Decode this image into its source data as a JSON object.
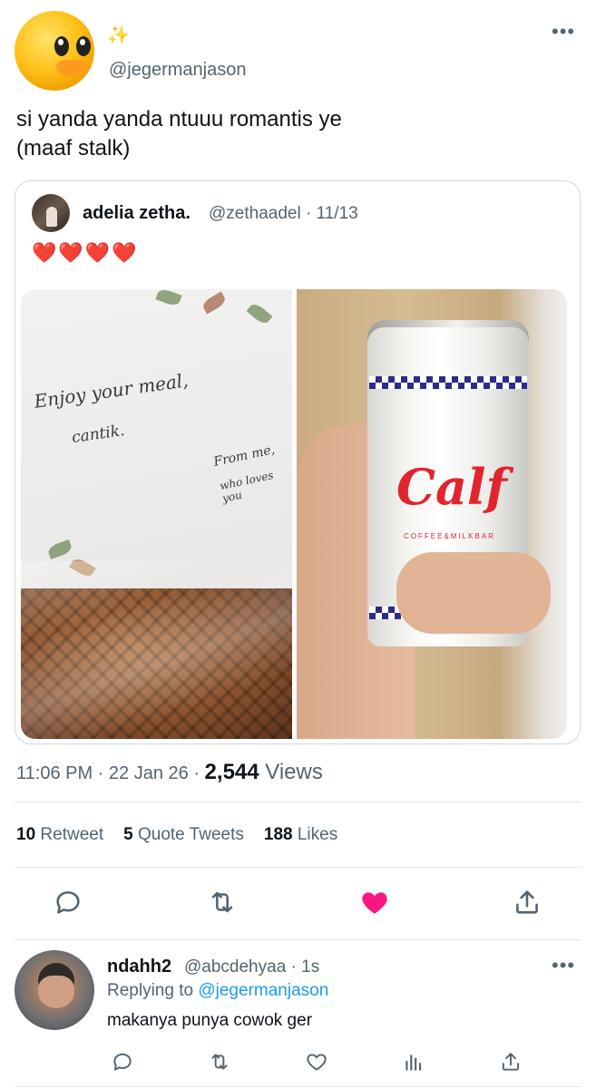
{
  "main_tweet": {
    "sparkle": "✨",
    "handle": "@jegermanjason",
    "text": "si yanda yanda ntuuu romantis ye\n(maaf stalk)",
    "more": "•••"
  },
  "quoted_tweet": {
    "name": "adelia zetha.",
    "handle": "@zethaadel · 11/13",
    "hearts": "❤️❤️❤️❤️",
    "photos": {
      "left_note_line1": "Enjoy your meal,",
      "left_note_line2": "cantik.",
      "left_note_from1": "From me,",
      "left_note_from2": "who loves you",
      "right_can_brand": "Calf",
      "right_can_sub": "COFFEE&MILKBAR"
    }
  },
  "meta": {
    "time": "11:06 PM",
    "date": "22 Jan 26",
    "sep1": " · ",
    "sep2": " · ",
    "views_count": "2,544",
    "views_label": " Views"
  },
  "stats": {
    "retweets_count": "10",
    "retweets_label": "Retweet",
    "quotes_count": "5",
    "quotes_label": "Quote Tweets",
    "likes_count": "188",
    "likes_label": "Likes"
  },
  "actions": [
    "reply-icon",
    "retweet-icon",
    "like-icon-filled",
    "share-icon"
  ],
  "reply": {
    "name": "ndahh2",
    "handle": "@abcdehyaa · 1s",
    "replying_prefix": "Replying to ",
    "replying_handle": "@jegermanjason",
    "text": "makanya punya cowok ger",
    "more": "•••",
    "actions": [
      "reply-icon",
      "retweet-icon",
      "like-icon",
      "analytics-icon",
      "share-icon"
    ]
  },
  "colors": {
    "text": "#0f1419",
    "secondary": "#536471",
    "link": "#1d9bf0",
    "like": "#f91880",
    "divider": "#e1e8ed"
  }
}
